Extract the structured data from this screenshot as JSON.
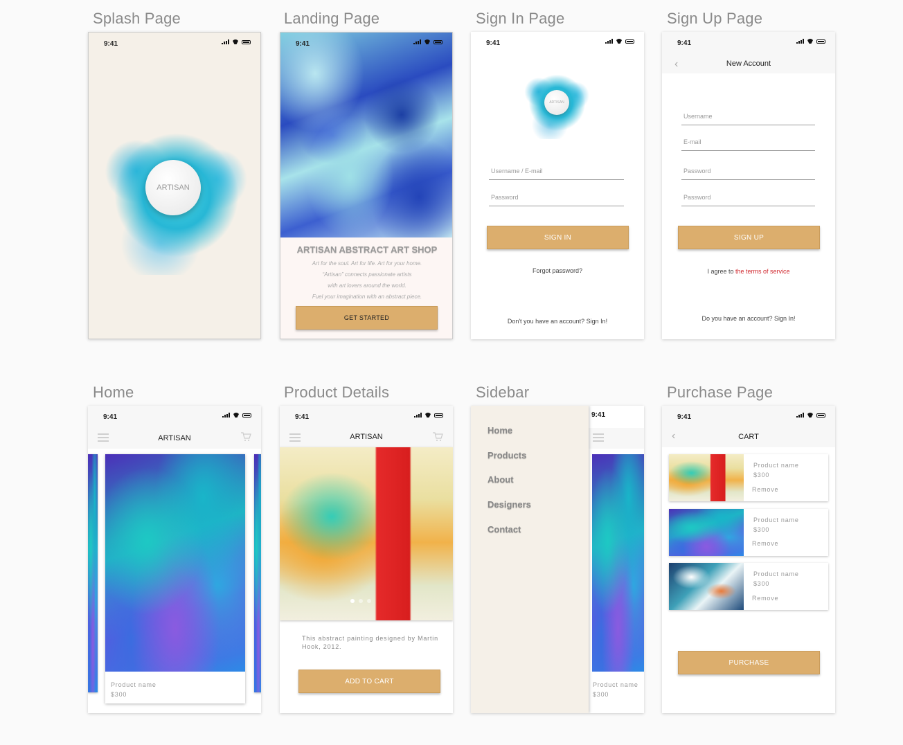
{
  "sections": {
    "splash": "Splash Page",
    "landing": "Landing Page",
    "signin": "Sign In Page",
    "signup": "Sign Up Page",
    "home": "Home",
    "product": "Product Details",
    "sidebar": "Sidebar",
    "purchase": "Purchase Page"
  },
  "status_time": "9:41",
  "splash": {
    "logo": "ARTISAN"
  },
  "landing": {
    "title": "ARTISAN ABSTRACT ART SHOP",
    "line1": "Art for the soul. Art for life. Art for your home.",
    "line2": "“Artisan” connects passionate artists",
    "line3": "with art lovers around the world.",
    "line4": "Fuel your imagination with an  abstract piece.",
    "button": "GET STARTED"
  },
  "signin": {
    "logo": "ARTISAN",
    "username_placeholder": "Username / E-mail",
    "password_placeholder": "Password",
    "button": "SIGN IN",
    "forgot": "Forgot password?",
    "signup_prompt": "Don't you have an account? Sign In!"
  },
  "signup": {
    "title": "New Account",
    "username_placeholder": "Username",
    "email_placeholder": "E-mail",
    "password_placeholder": "Password",
    "password2_placeholder": "Password",
    "button": "SIGN UP",
    "agree_prefix": "I agree to ",
    "agree_link": "the terms of service",
    "signin_prompt": "Do you have an account? Sign In!"
  },
  "home": {
    "title": "ARTISAN",
    "product_name": "Product name",
    "product_price": "$300"
  },
  "product": {
    "title": "ARTISAN",
    "description": "This abstract painting designed by Martin Hook, 2012.",
    "button": "ADD TO CART"
  },
  "sidebar": {
    "items": [
      "Home",
      "Products",
      "About",
      "Designers",
      "Contact"
    ],
    "product_name": "Product name",
    "product_price": "$300"
  },
  "purchase": {
    "title": "CART",
    "items": [
      {
        "name": "Product name",
        "price": "$300",
        "remove": "Remove"
      },
      {
        "name": "Product name",
        "price": "$300",
        "remove": "Remove"
      },
      {
        "name": "Product name",
        "price": "$300",
        "remove": "Remove"
      }
    ],
    "button": "PURCHASE"
  },
  "colors": {
    "accent": "#dcae6d",
    "link": "#d0282e",
    "splash_bg": "#f5f0e8"
  }
}
